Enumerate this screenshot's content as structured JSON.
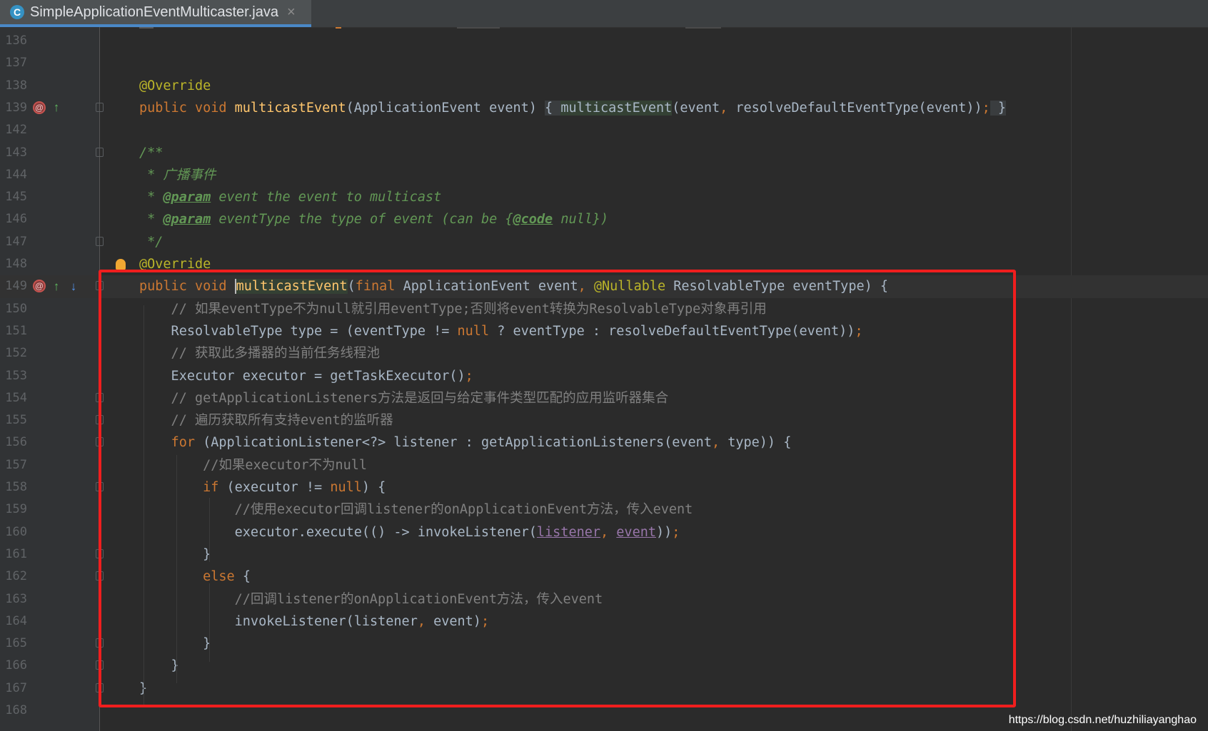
{
  "tab": {
    "icon_letter": "C",
    "title": "SimpleApplicationEventMulticaster.java",
    "close_glyph": "×"
  },
  "lines": [
    {
      "n": "136",
      "tokens": []
    },
    {
      "n": "137",
      "tokens": []
    },
    {
      "n": "138",
      "tokens": [
        {
          "t": "@Override",
          "c": "ann"
        }
      ]
    },
    {
      "n": "139",
      "tokens": [
        {
          "t": "public void ",
          "c": "kw"
        },
        {
          "t": "multicastEvent",
          "c": "fn"
        },
        {
          "t": "(ApplicationEvent event) "
        },
        {
          "t": "{ ",
          "c": "fb"
        },
        {
          "t": "multicastEvent",
          "c": "hl"
        },
        {
          "t": "(event"
        },
        {
          "t": ", ",
          "c": "kw"
        },
        {
          "t": "resolveDefaultEventType(event))"
        },
        {
          "t": ";",
          "c": "kw"
        },
        {
          "t": " }",
          "c": "fb"
        }
      ]
    },
    {
      "n": "142",
      "tokens": []
    },
    {
      "n": "143",
      "tokens": [
        {
          "t": "/**",
          "c": "doc"
        }
      ]
    },
    {
      "n": "144",
      "tokens": [
        {
          "t": " * 广播事件",
          "c": "doc"
        }
      ]
    },
    {
      "n": "145",
      "tokens": [
        {
          "t": " * ",
          "c": "doc"
        },
        {
          "t": "@param",
          "c": "doctag"
        },
        {
          "t": " event the event to multicast",
          "c": "doc"
        }
      ]
    },
    {
      "n": "146",
      "tokens": [
        {
          "t": " * ",
          "c": "doc"
        },
        {
          "t": "@param",
          "c": "doctag"
        },
        {
          "t": " eventType the type of event (can be {",
          "c": "doc"
        },
        {
          "t": "@code",
          "c": "doctag"
        },
        {
          "t": " null})",
          "c": "doc"
        }
      ]
    },
    {
      "n": "147",
      "tokens": [
        {
          "t": " */",
          "c": "doc"
        }
      ]
    },
    {
      "n": "148",
      "tokens": [
        {
          "t": "@Override",
          "c": "ann"
        }
      ]
    },
    {
      "n": "149",
      "tokens": [
        {
          "t": "public void ",
          "c": "kw"
        },
        {
          "t": "multicastEvent",
          "c": "fn hl caret"
        },
        {
          "t": "("
        },
        {
          "t": "final ",
          "c": "kw"
        },
        {
          "t": "ApplicationEvent event"
        },
        {
          "t": ", ",
          "c": "kw"
        },
        {
          "t": "@Nullable ",
          "c": "ann"
        },
        {
          "t": "ResolvableType eventType) {"
        }
      ]
    },
    {
      "n": "150",
      "tokens": [
        {
          "t": "    // 如果eventType不为null就引用eventType;否则将event转换为ResolvableType对象再引用",
          "c": "cmt"
        }
      ]
    },
    {
      "n": "151",
      "tokens": [
        {
          "t": "    ResolvableType type = (eventType != "
        },
        {
          "t": "null",
          "c": "kw"
        },
        {
          "t": " ? eventType : resolveDefaultEventType(event))"
        },
        {
          "t": ";",
          "c": "kw"
        }
      ]
    },
    {
      "n": "152",
      "tokens": [
        {
          "t": "    // 获取此多播器的当前任务线程池",
          "c": "cmt"
        }
      ]
    },
    {
      "n": "153",
      "tokens": [
        {
          "t": "    Executor executor = getTaskExecutor()"
        },
        {
          "t": ";",
          "c": "kw"
        }
      ]
    },
    {
      "n": "154",
      "tokens": [
        {
          "t": "    // getApplicationListeners方法是返回与给定事件类型匹配的应用监听器集合",
          "c": "cmt"
        }
      ]
    },
    {
      "n": "155",
      "tokens": [
        {
          "t": "    // 遍历获取所有支持event的监听器",
          "c": "cmt"
        }
      ]
    },
    {
      "n": "156",
      "tokens": [
        {
          "t": "    "
        },
        {
          "t": "for ",
          "c": "kw"
        },
        {
          "t": "(ApplicationListener<?> listener : getApplicationListeners(event"
        },
        {
          "t": ", ",
          "c": "kw"
        },
        {
          "t": "type)) {"
        }
      ]
    },
    {
      "n": "157",
      "tokens": [
        {
          "t": "        //如果executor不为null",
          "c": "cmt"
        }
      ]
    },
    {
      "n": "158",
      "tokens": [
        {
          "t": "        "
        },
        {
          "t": "if ",
          "c": "kw"
        },
        {
          "t": "(executor != "
        },
        {
          "t": "null",
          "c": "kw"
        },
        {
          "t": ") {"
        }
      ]
    },
    {
      "n": "159",
      "tokens": [
        {
          "t": "            //使用executor回调listener的onApplicationEvent方法，传入event",
          "c": "cmt"
        }
      ]
    },
    {
      "n": "160",
      "tokens": [
        {
          "t": "            executor.execute(() -> invokeListener("
        },
        {
          "t": "listener",
          "c": "var"
        },
        {
          "t": ", ",
          "c": "kw"
        },
        {
          "t": "event",
          "c": "var"
        },
        {
          "t": "))"
        },
        {
          "t": ";",
          "c": "kw"
        }
      ]
    },
    {
      "n": "161",
      "tokens": [
        {
          "t": "        }"
        }
      ]
    },
    {
      "n": "162",
      "tokens": [
        {
          "t": "        "
        },
        {
          "t": "else ",
          "c": "kw"
        },
        {
          "t": "{"
        }
      ]
    },
    {
      "n": "163",
      "tokens": [
        {
          "t": "            //回调listener的onApplicationEvent方法，传入event",
          "c": "cmt"
        }
      ]
    },
    {
      "n": "164",
      "tokens": [
        {
          "t": "            invokeListener(listener"
        },
        {
          "t": ", ",
          "c": "kw"
        },
        {
          "t": "event)"
        },
        {
          "t": ";",
          "c": "kw"
        }
      ]
    },
    {
      "n": "165",
      "tokens": [
        {
          "t": "        }"
        }
      ]
    },
    {
      "n": "166",
      "tokens": [
        {
          "t": "    }"
        }
      ]
    },
    {
      "n": "167",
      "tokens": [
        {
          "t": "}"
        }
      ]
    },
    {
      "n": "168",
      "tokens": []
    }
  ],
  "gutter_icons": {
    "139": [
      {
        "name": "breakpoint-method-icon",
        "glyph": "@",
        "cls": "gi-red"
      },
      {
        "name": "implements-icon",
        "glyph": "↑",
        "cls": "gi-green"
      }
    ],
    "149": [
      {
        "name": "breakpoint-method-icon",
        "glyph": "@",
        "cls": "gi-red"
      },
      {
        "name": "implements-icon",
        "glyph": "↑",
        "cls": "gi-green"
      },
      {
        "name": "overridden-icon",
        "glyph": "↓",
        "cls": "gi-blue"
      }
    ]
  },
  "fold_markers": [
    "139",
    "143",
    "147",
    "149",
    "154",
    "155",
    "156",
    "158",
    "161",
    "162",
    "165",
    "166",
    "167"
  ],
  "current_line": "149",
  "bulb_line": "148",
  "watermark": "https://blog.csdn.net/huzhiliayanghao",
  "colors": {
    "background": "#2b2b2b",
    "keyword": "#cc7832",
    "annotation": "#bbb529",
    "method": "#ffc66d",
    "comment": "#808080",
    "doc": "#629755",
    "highlight_box": "#f01e1e"
  }
}
